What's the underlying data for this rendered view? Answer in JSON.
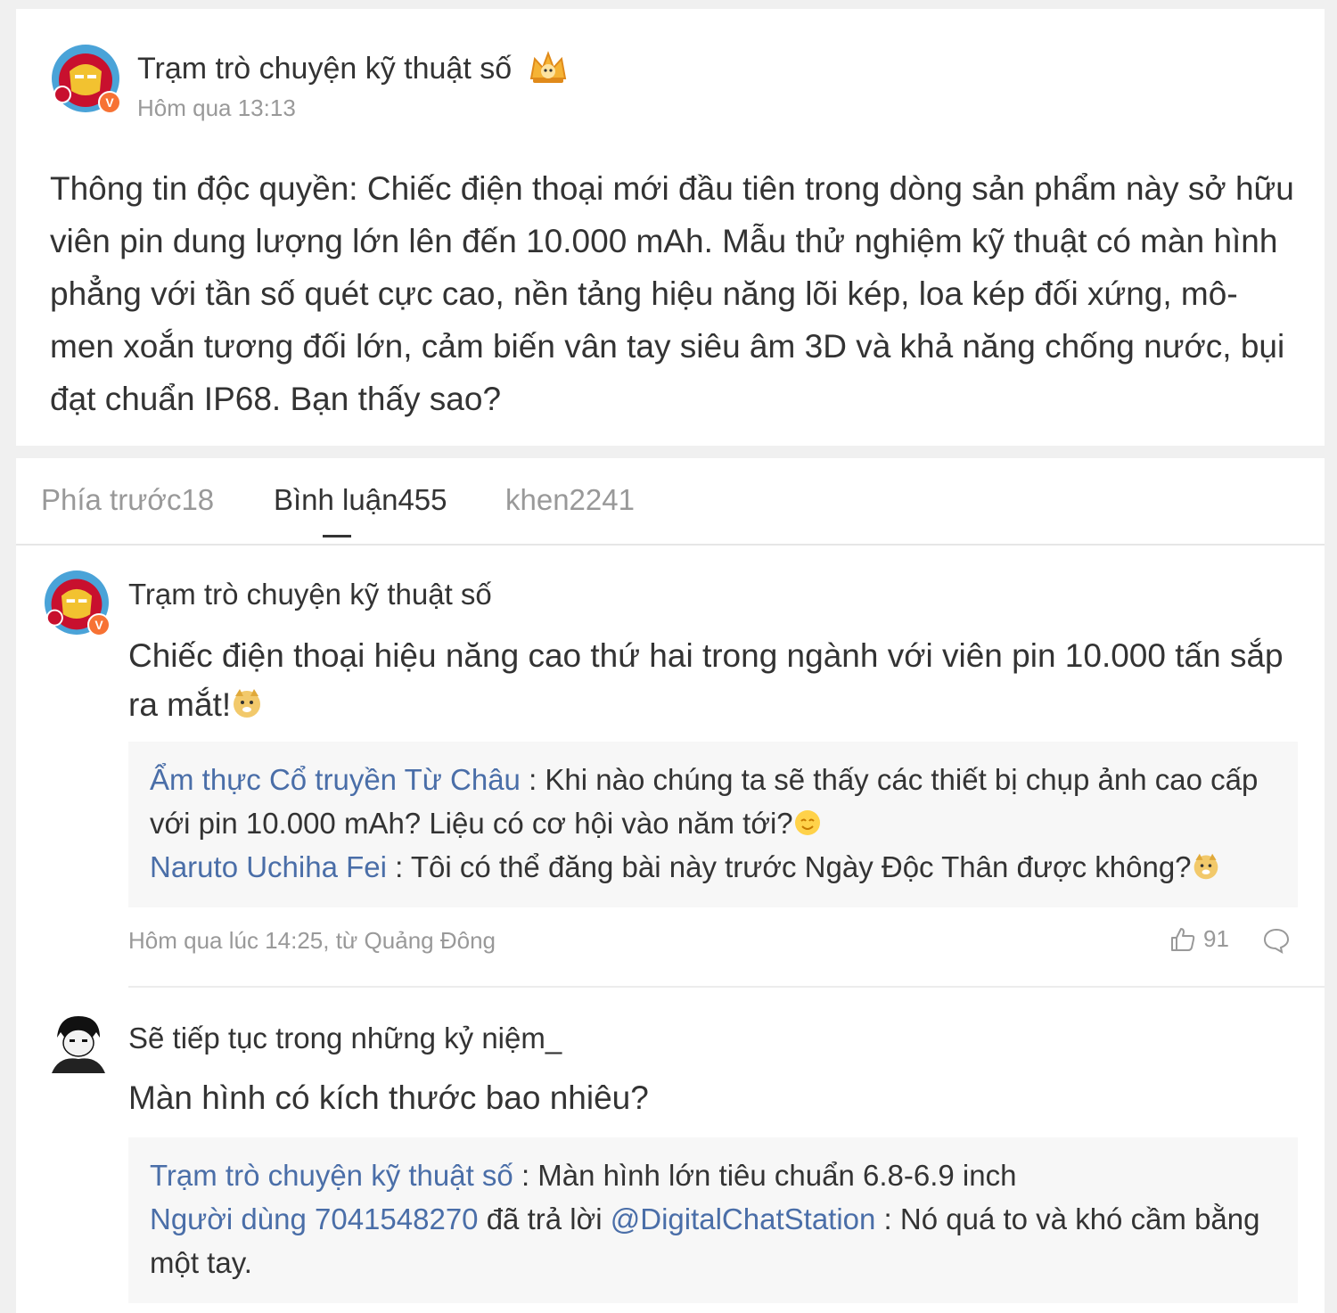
{
  "post": {
    "author": "Trạm trò chuyện kỹ thuật số",
    "time": "Hôm qua 13:13",
    "text": "Thông tin độc quyền: Chiếc điện thoại mới đầu tiên trong dòng sản phẩm này sở hữu viên pin dung lượng lớn lên đến 10.000 mAh. Mẫu thử nghiệm kỹ thuật có màn hình phẳng với tần số quét cực cao, nền tảng hiệu năng lõi kép, loa kép đối xứng, mô-men xoắn tương đối lớn, cảm biến vân tay siêu âm 3D và khả năng chống nước, bụi đạt chuẩn IP68. Bạn thấy sao?"
  },
  "tabs": [
    {
      "label": "Phía trước18"
    },
    {
      "label": "Bình luận455"
    },
    {
      "label": "khen2241"
    }
  ],
  "comments": [
    {
      "author": "Trạm trò chuyện kỹ thuật số",
      "text": "Chiếc điện thoại hiệu năng cao thứ hai trong ngành với viên pin 10.000 tấn sắp ra mắt!",
      "replies": [
        {
          "name": "Ẩm thực Cổ truyền Từ Châu",
          "sep": " : ",
          "text": "Khi nào chúng ta sẽ thấy các thiết bị chụp ảnh cao cấp với pin 10.000 mAh? Liệu có cơ hội vào năm tới?"
        },
        {
          "name": "Naruto Uchiha Fei",
          "sep": " : ",
          "text": "Tôi có thể đăng bài này trước Ngày Độc Thân được không?"
        }
      ],
      "meta": "Hôm qua lúc 14:25, từ Quảng Đông",
      "likes": "91"
    },
    {
      "author": "Sẽ tiếp tục trong những kỷ niệm_",
      "text": "Màn hình có kích thước bao nhiêu?",
      "replies": [
        {
          "name": "Trạm trò chuyện kỹ thuật số",
          "sep": " : ",
          "text": "Màn hình lớn tiêu chuẩn 6.8-6.9 inch"
        },
        {
          "name": "Người dùng 7041548270",
          "mid": " đã trả lời ",
          "mention": "@DigitalChatStation",
          "sep": " : ",
          "text": "Nó quá to và khó cầm bằng một tay."
        }
      ]
    }
  ],
  "icons": {
    "verified_badge": "V",
    "crown": "crown-icon",
    "like": "thumbs-up-icon",
    "comment": "comment-bubble-icon",
    "emoji_doge": "doge-emoji-icon",
    "emoji_smile": "smile-emoji-icon"
  },
  "colors": {
    "link": "#4a6ea8",
    "badge": "#f77234",
    "muted": "#999999"
  }
}
